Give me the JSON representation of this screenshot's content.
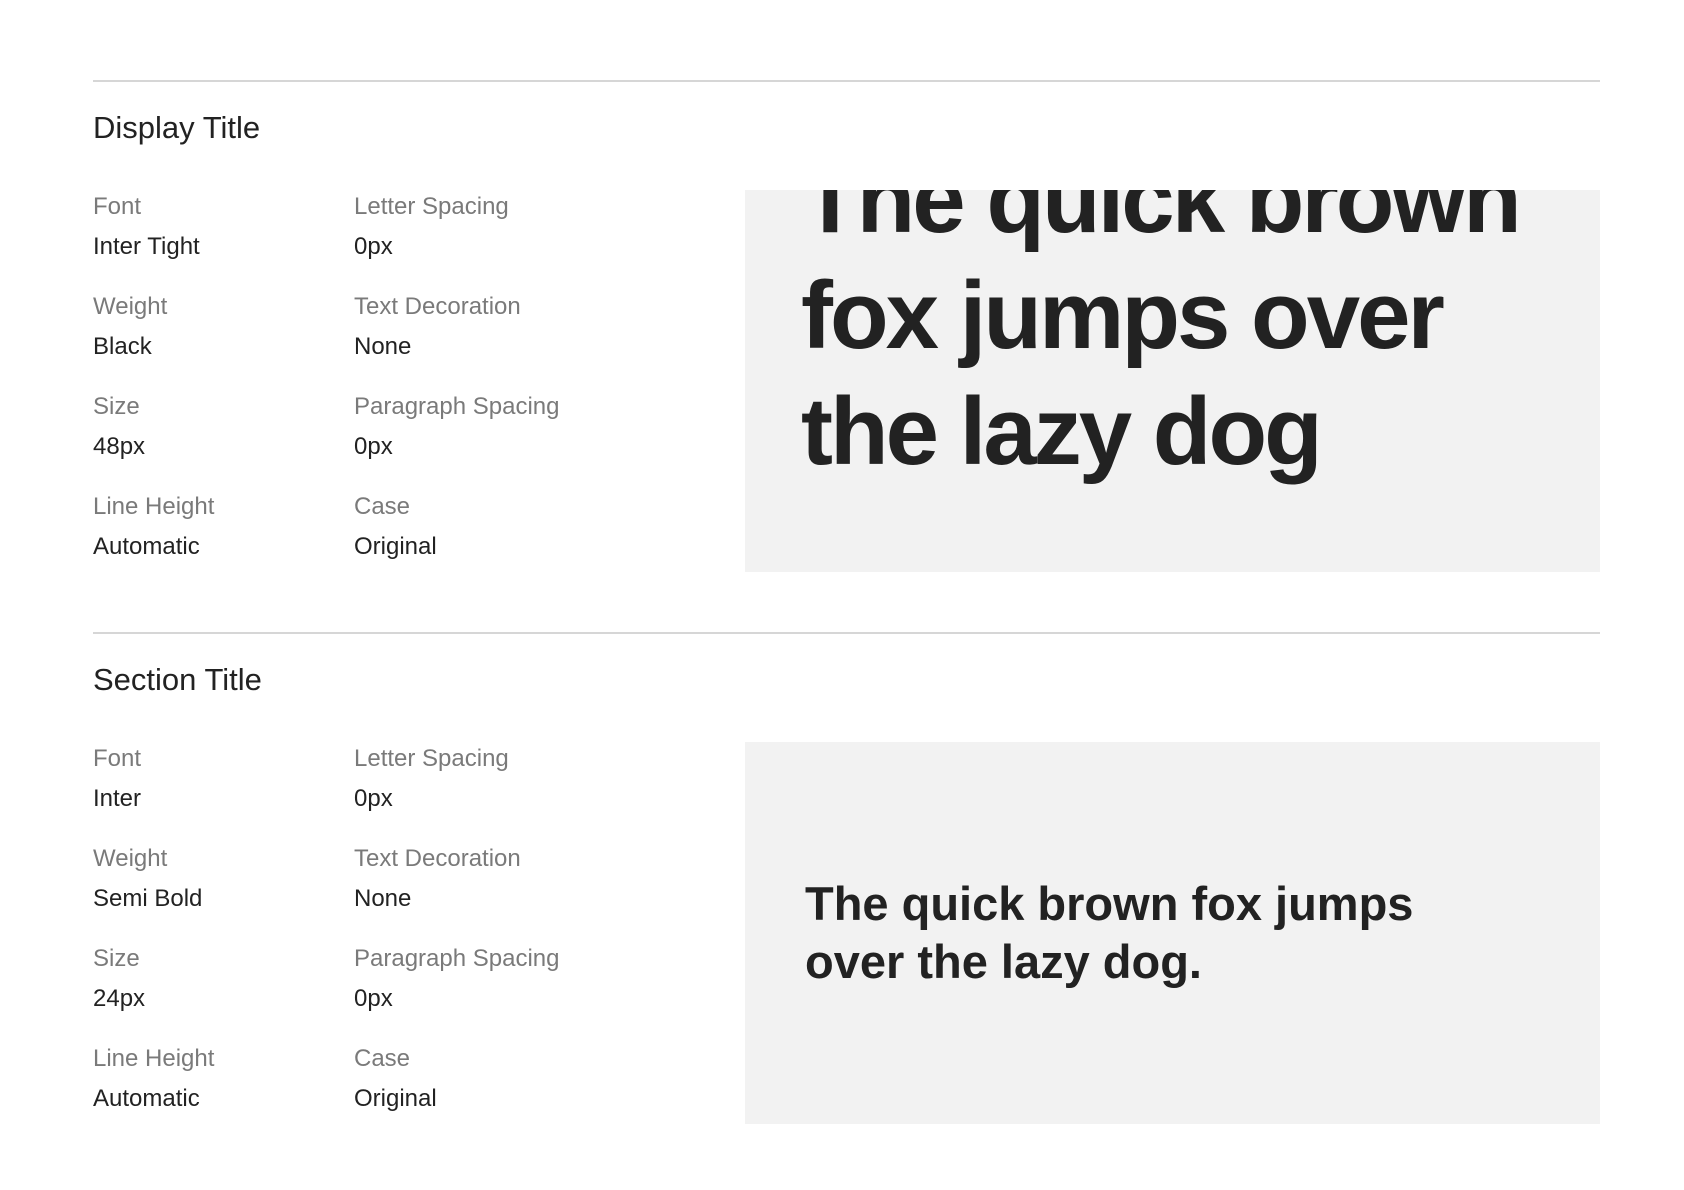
{
  "styles": [
    {
      "title": "Display Title",
      "properties": {
        "font": {
          "label": "Font",
          "value": "Inter Tight"
        },
        "weight": {
          "label": "Weight",
          "value": "Black"
        },
        "size": {
          "label": "Size",
          "value": "48px"
        },
        "line_height": {
          "label": "Line Height",
          "value": "Automatic"
        },
        "letter_spacing": {
          "label": "Letter Spacing",
          "value": "0px"
        },
        "text_decoration": {
          "label": "Text Decoration",
          "value": "None"
        },
        "paragraph_spacing": {
          "label": "Paragraph Spacing",
          "value": "0px"
        },
        "case": {
          "label": "Case",
          "value": "Original"
        }
      },
      "preview_text": "The quick brown fox jumps over the lazy dog"
    },
    {
      "title": "Section Title",
      "properties": {
        "font": {
          "label": "Font",
          "value": "Inter"
        },
        "weight": {
          "label": "Weight",
          "value": "Semi Bold"
        },
        "size": {
          "label": "Size",
          "value": "24px"
        },
        "line_height": {
          "label": "Line Height",
          "value": "Automatic"
        },
        "letter_spacing": {
          "label": "Letter Spacing",
          "value": "0px"
        },
        "text_decoration": {
          "label": "Text Decoration",
          "value": "None"
        },
        "paragraph_spacing": {
          "label": "Paragraph Spacing",
          "value": "0px"
        },
        "case": {
          "label": "Case",
          "value": "Original"
        }
      },
      "preview_text": "The quick brown fox jumps over the lazy dog."
    }
  ],
  "colors": {
    "text": "#222222",
    "label": "#7a7a7a",
    "divider": "#d6d6d6",
    "preview_bg": "#f2f2f2"
  }
}
